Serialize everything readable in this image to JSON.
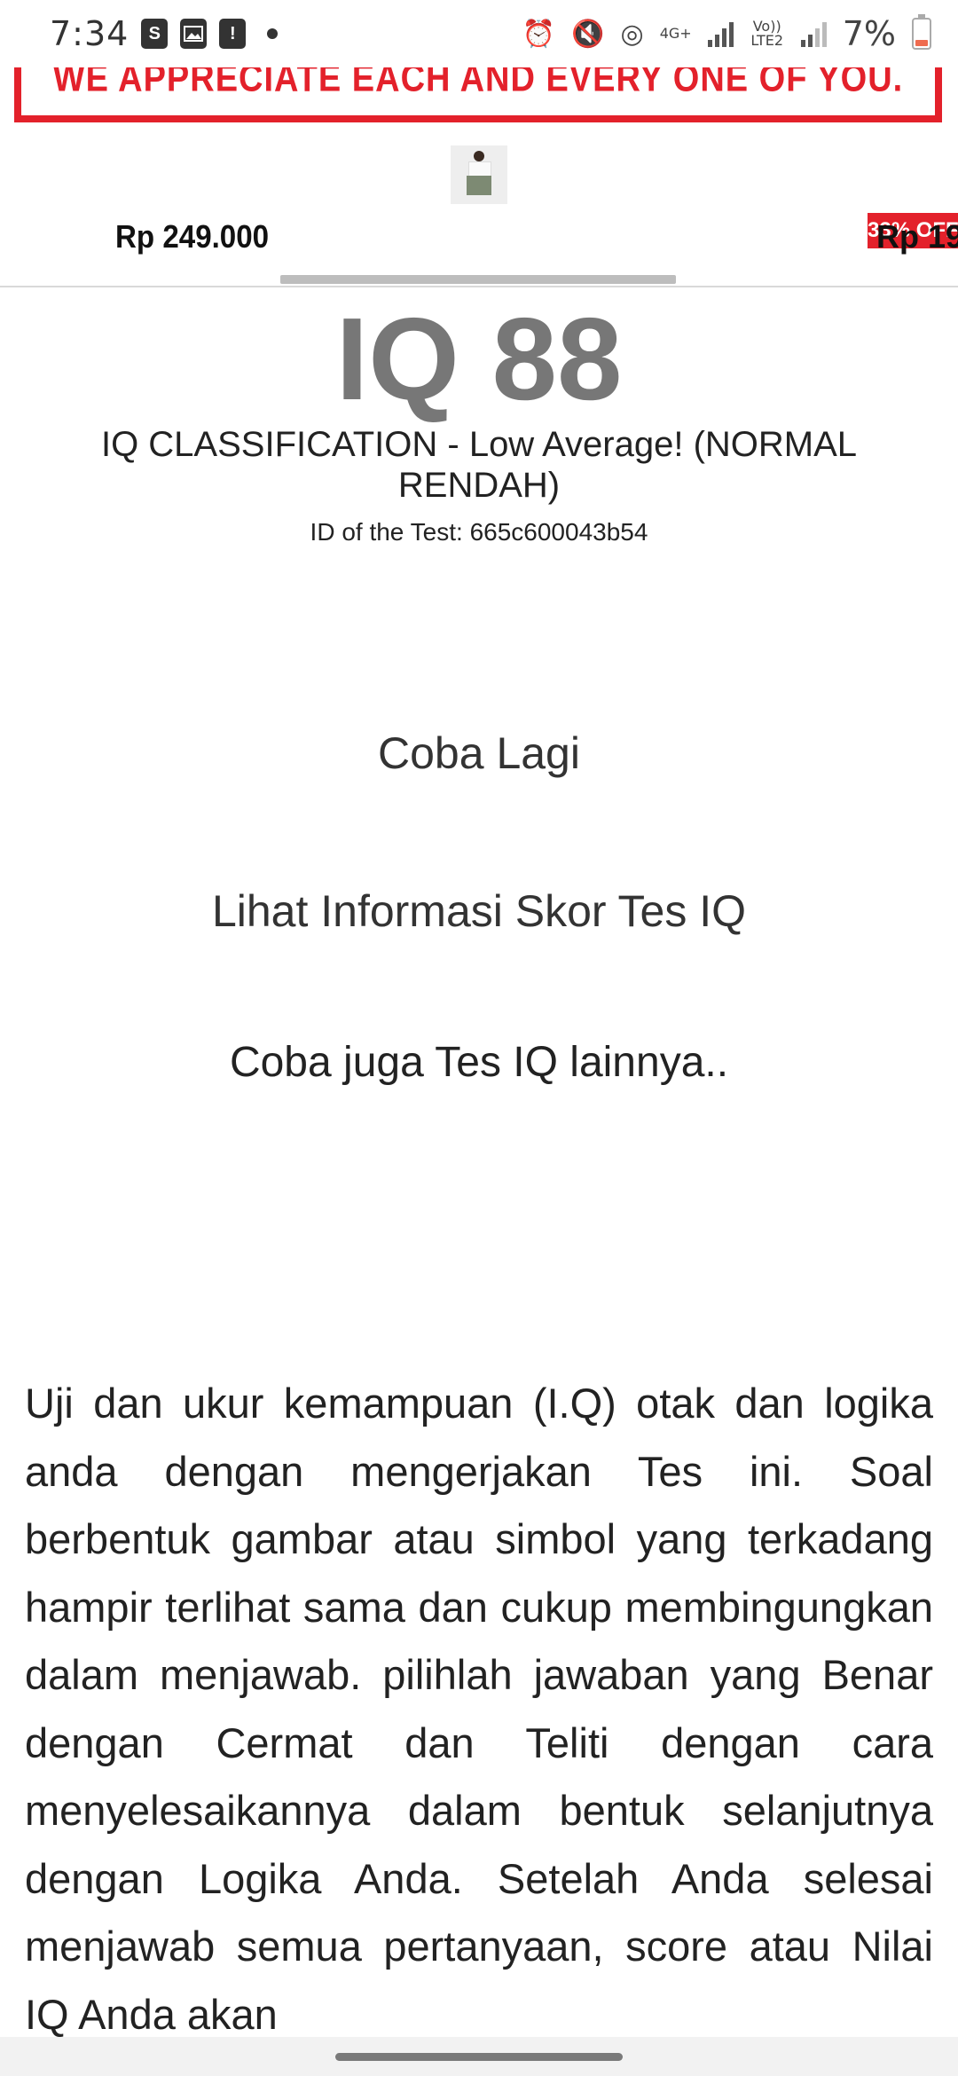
{
  "status_bar": {
    "time": "7:34",
    "network_label": "4G+",
    "volte_label": "Vo)) LTE2",
    "battery": "7%",
    "icons": [
      "shopee-icon",
      "gallery-icon",
      "alert-icon",
      "alarm-icon",
      "mute-icon",
      "hotspot-icon"
    ]
  },
  "ad": {
    "slogan": "WE APPRECIATE EACH AND EVERY ONE OF YOU.",
    "price_left": "Rp 249.000",
    "price_right": "Rp 19",
    "discount_badge": "33% OFF",
    "accent_color": "#e3212b"
  },
  "result": {
    "score": "IQ 88",
    "classification": "IQ CLASSIFICATION - Low Average! (NORMAL RENDAH)",
    "test_id": "ID of the Test: 665c600043b54"
  },
  "links": {
    "retry": "Coba Lagi",
    "info": "Lihat Informasi Skor Tes IQ",
    "other_tests": "Coba juga Tes IQ lainnya.."
  },
  "description": "Uji dan ukur kemampuan (I.Q) otak dan logika anda dengan mengerjakan Tes ini. Soal berbentuk gambar atau simbol yang terkadang hampir terlihat sama dan cukup membingungkan dalam menjawab. pilihlah jawaban yang Benar dengan Cermat dan Teliti dengan cara menyelesaikannya dalam bentuk selanjutnya dengan Logika Anda. Setelah Anda selesai menjawab semua pertanyaan, score atau Nilai IQ Anda akan"
}
